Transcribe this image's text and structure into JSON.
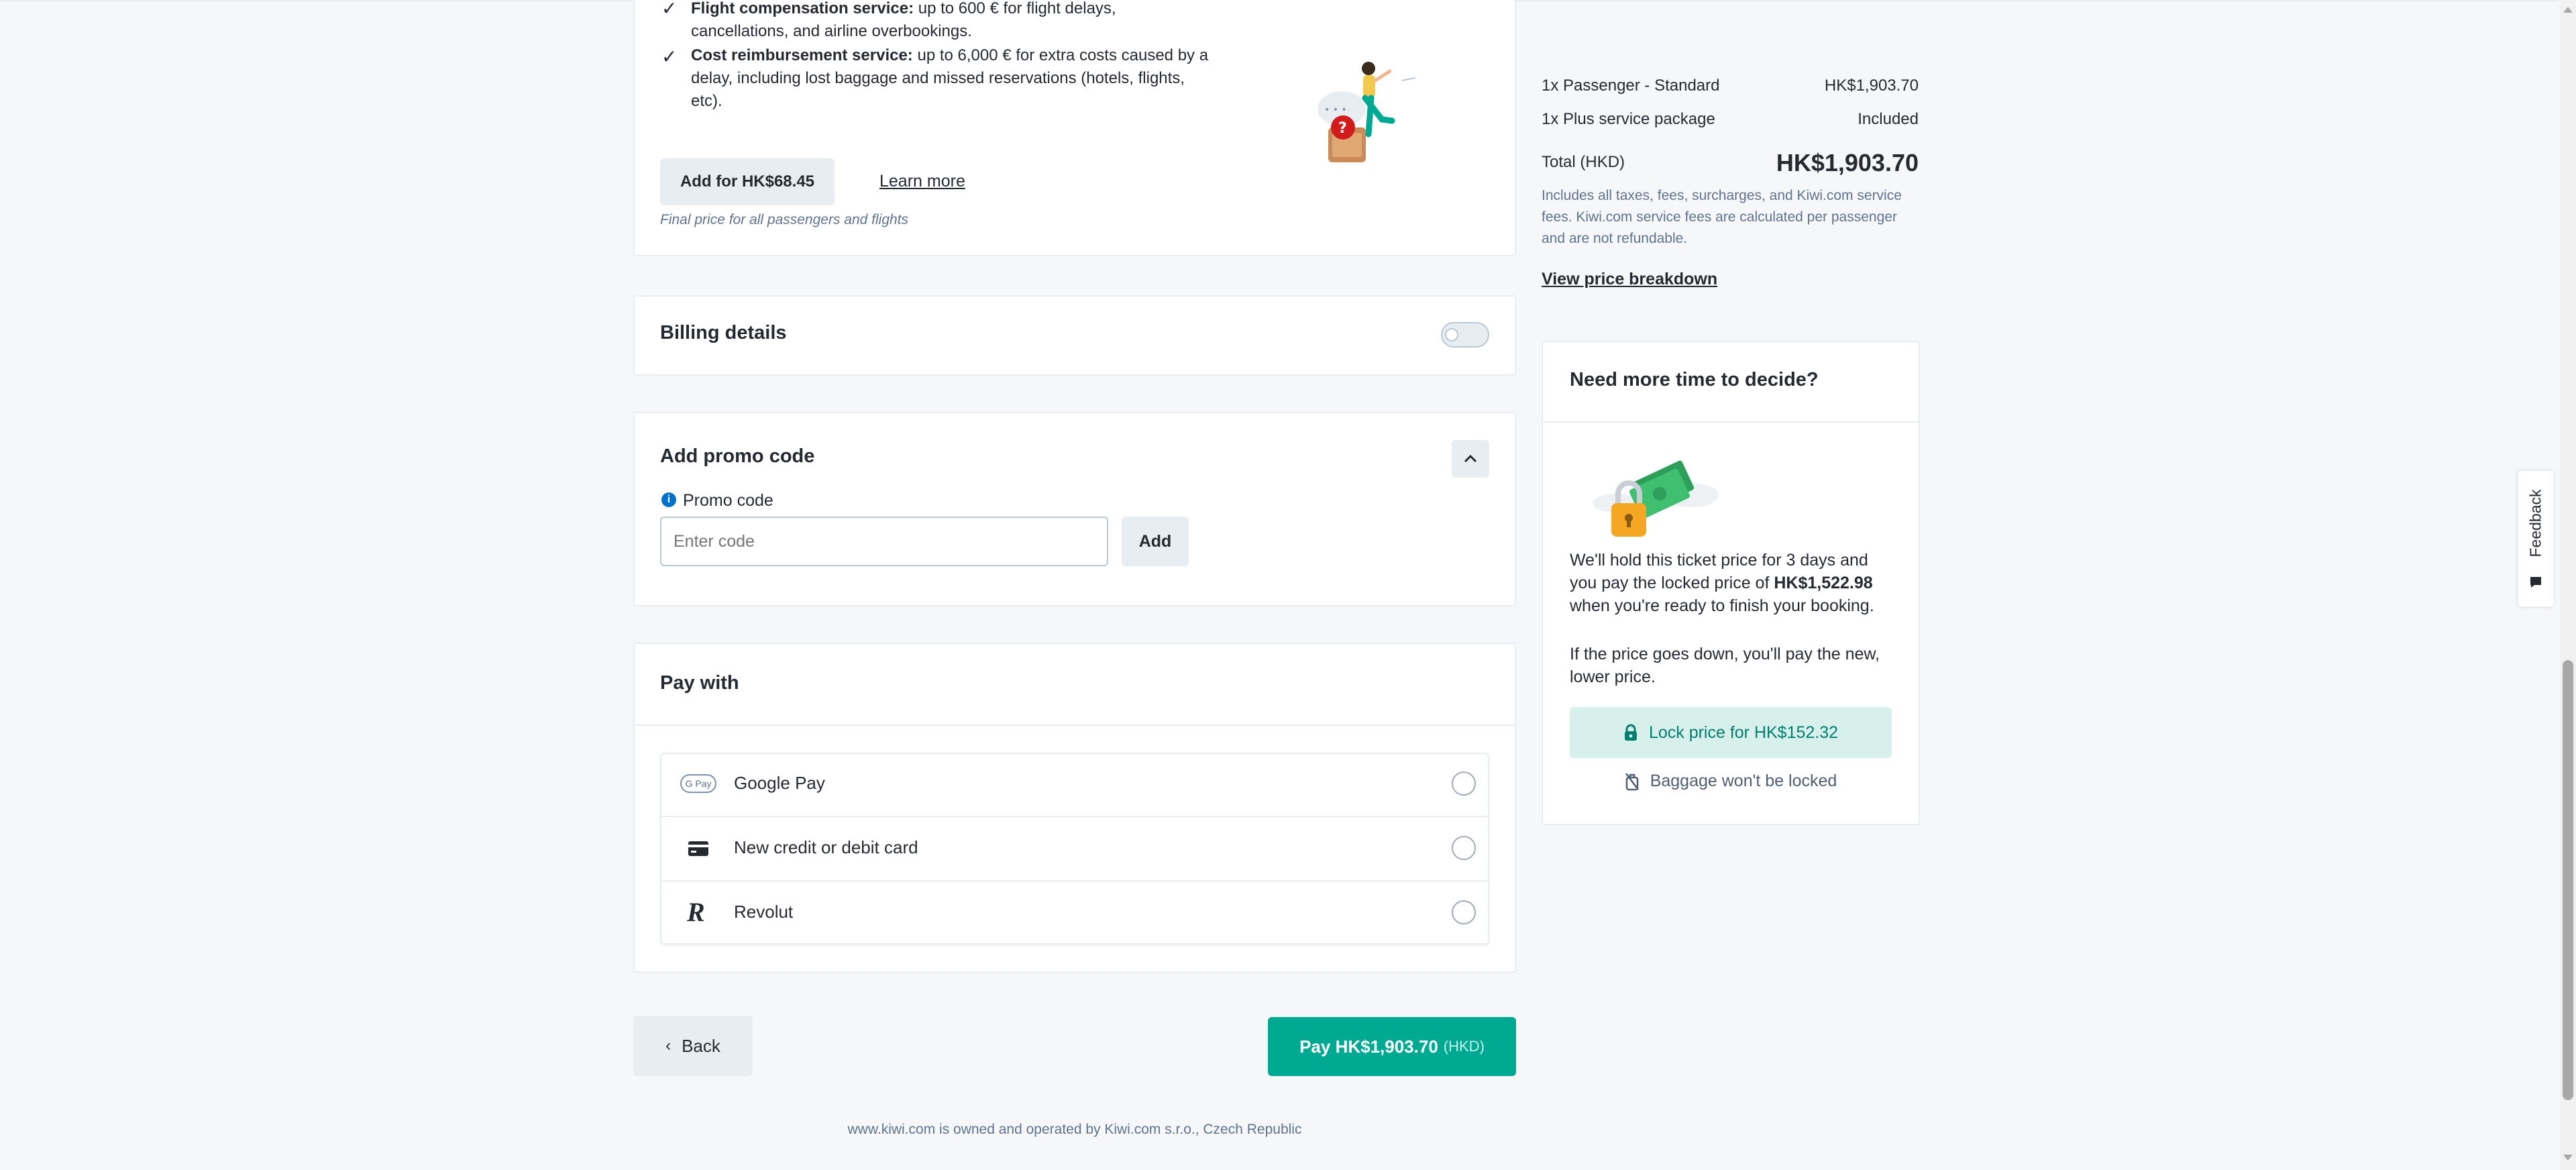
{
  "insurance": {
    "benefits": [
      {
        "title": "Flight compensation service:",
        "text": " up to 600 € for flight delays, cancellations, and airline overbookings."
      },
      {
        "title": "Cost reimbursement service:",
        "text": " up to 6,000 € for extra costs caused by a delay, including lost baggage and missed reservations (hotels, flights, etc)."
      }
    ],
    "add_button": "Add for HK$68.45",
    "learn_more": "Learn more",
    "final_price_note": "Final price for all passengers and flights"
  },
  "billing": {
    "title": "Billing details",
    "toggle_on": false
  },
  "promo": {
    "title": "Add promo code",
    "field_label": "Promo code",
    "placeholder": "Enter code",
    "add_button": "Add"
  },
  "pay_with": {
    "title": "Pay with",
    "options": [
      {
        "label": "Google Pay",
        "icon": "google-pay-icon",
        "badge": "G Pay"
      },
      {
        "label": "New credit or debit card",
        "icon": "credit-card-icon"
      },
      {
        "label": "Revolut",
        "icon": "revolut-icon",
        "badge": "R"
      }
    ]
  },
  "actions": {
    "back": "Back",
    "pay": "Pay HK$1,903.70",
    "pay_currency": "(HKD)"
  },
  "footer": {
    "text": "www.kiwi.com is owned and operated by Kiwi.com s.r.o., Czech Republic"
  },
  "summary": {
    "rows": [
      {
        "label": "1x Passenger - Standard",
        "value": "HK$1,903.70"
      },
      {
        "label": "1x Plus service package",
        "value": "Included"
      }
    ],
    "total_label": "Total (HKD)",
    "total_value": "HK$1,903.70",
    "note": "Includes all taxes, fees, surcharges, and Kiwi.com service fees. Kiwi.com service fees are calculated per passenger and are not refundable.",
    "breakdown_link": "View price breakdown"
  },
  "price_lock": {
    "title": "Need more time to decide?",
    "text_1": "We'll hold this ticket price for 3 days and you pay the locked price of ",
    "locked_price": "HK$1,522.98",
    "text_2": " when you're ready to finish your booking.",
    "text_3": "If the price goes down, you'll pay the new, lower price.",
    "button": "Lock price for HK$152.32",
    "baggage_note": "Baggage won't be locked"
  },
  "feedback": {
    "label": "Feedback"
  },
  "colors": {
    "primary": "#00a991",
    "primary_dark": "#007f6d",
    "lock_bg": "#d7f0ec",
    "info_blue": "#0172cb",
    "text_muted": "#5f738c"
  }
}
